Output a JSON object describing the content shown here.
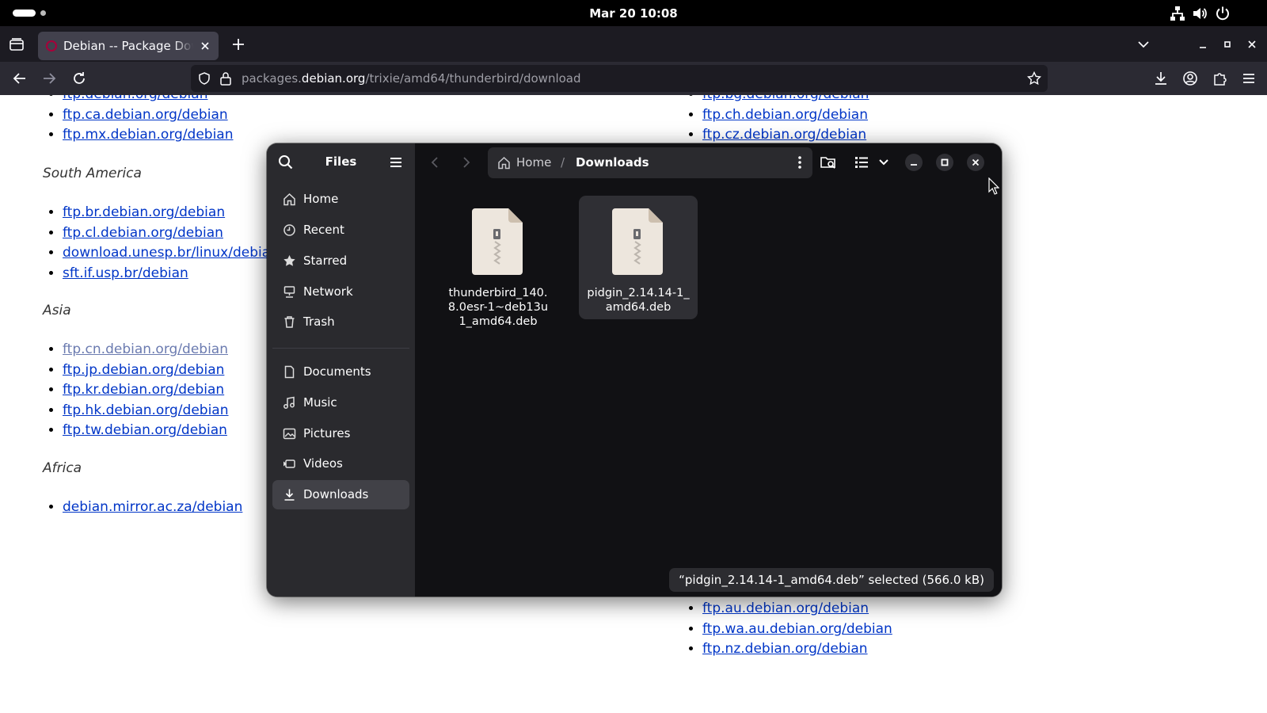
{
  "topbar": {
    "clock": "Mar 20  10:08",
    "icons": [
      "network-icon",
      "volume-icon",
      "power-icon"
    ]
  },
  "browser": {
    "tab": {
      "title": "Debian -- Package Download",
      "favicon": "debian-swirl-icon"
    },
    "url": {
      "prefix": "packages.",
      "host": "debian.org",
      "path": "/trixie/amd64/thunderbird/download"
    }
  },
  "page": {
    "left_column": {
      "top_links": [
        "ftp.debian.org/debian",
        "ftp.ca.debian.org/debian",
        "ftp.mx.debian.org/debian"
      ],
      "south_america": {
        "heading": "South America",
        "links": [
          "ftp.br.debian.org/debian",
          "ftp.cl.debian.org/debian",
          "download.unesp.br/linux/debian",
          "sft.if.usp.br/debian"
        ]
      },
      "asia": {
        "heading": "Asia",
        "links": [
          "ftp.cn.debian.org/debian",
          "ftp.jp.debian.org/debian",
          "ftp.kr.debian.org/debian",
          "ftp.hk.debian.org/debian",
          "ftp.tw.debian.org/debian"
        ]
      },
      "africa": {
        "heading": "Africa",
        "links": [
          "debian.mirror.ac.za/debian"
        ]
      }
    },
    "right_column": {
      "top_links": [
        "ftp.bg.debian.org/debian",
        "ftp.ch.debian.org/debian",
        "ftp.cz.debian.org/debian"
      ],
      "bottom_links": [
        "ftp.au.debian.org/debian",
        "ftp.wa.au.debian.org/debian",
        "ftp.nz.debian.org/debian"
      ]
    }
  },
  "files_window": {
    "title": "Files",
    "sidebar": {
      "places": [
        {
          "label": "Home",
          "icon": "home-icon"
        },
        {
          "label": "Recent",
          "icon": "clock-icon"
        },
        {
          "label": "Starred",
          "icon": "star-icon"
        },
        {
          "label": "Network",
          "icon": "network-drive-icon"
        },
        {
          "label": "Trash",
          "icon": "trash-icon"
        }
      ],
      "bookmarks": [
        {
          "label": "Documents",
          "icon": "document-icon"
        },
        {
          "label": "Music",
          "icon": "music-icon"
        },
        {
          "label": "Pictures",
          "icon": "picture-icon"
        },
        {
          "label": "Videos",
          "icon": "video-icon"
        },
        {
          "label": "Downloads",
          "icon": "download-icon",
          "active": true
        }
      ]
    },
    "path": {
      "home": "Home",
      "separator": "/",
      "current": "Downloads"
    },
    "files": [
      {
        "name": "thunderbird_140.8.0esr-1~deb13u1_amd64.deb",
        "icon": "package-archive-icon",
        "selected": false
      },
      {
        "name": "pidgin_2.14.14-1_amd64.deb",
        "icon": "package-archive-icon",
        "selected": true
      }
    ],
    "status": "“pidgin_2.14.14-1_amd64.deb” selected  (566.0 kB)"
  },
  "colors": {
    "link": "#0035c7",
    "link_visited": "#6b7bb0",
    "files_bg": "#111114",
    "sidebar_bg": "#2a2a2e",
    "selection_bg": "#2f2f34"
  }
}
